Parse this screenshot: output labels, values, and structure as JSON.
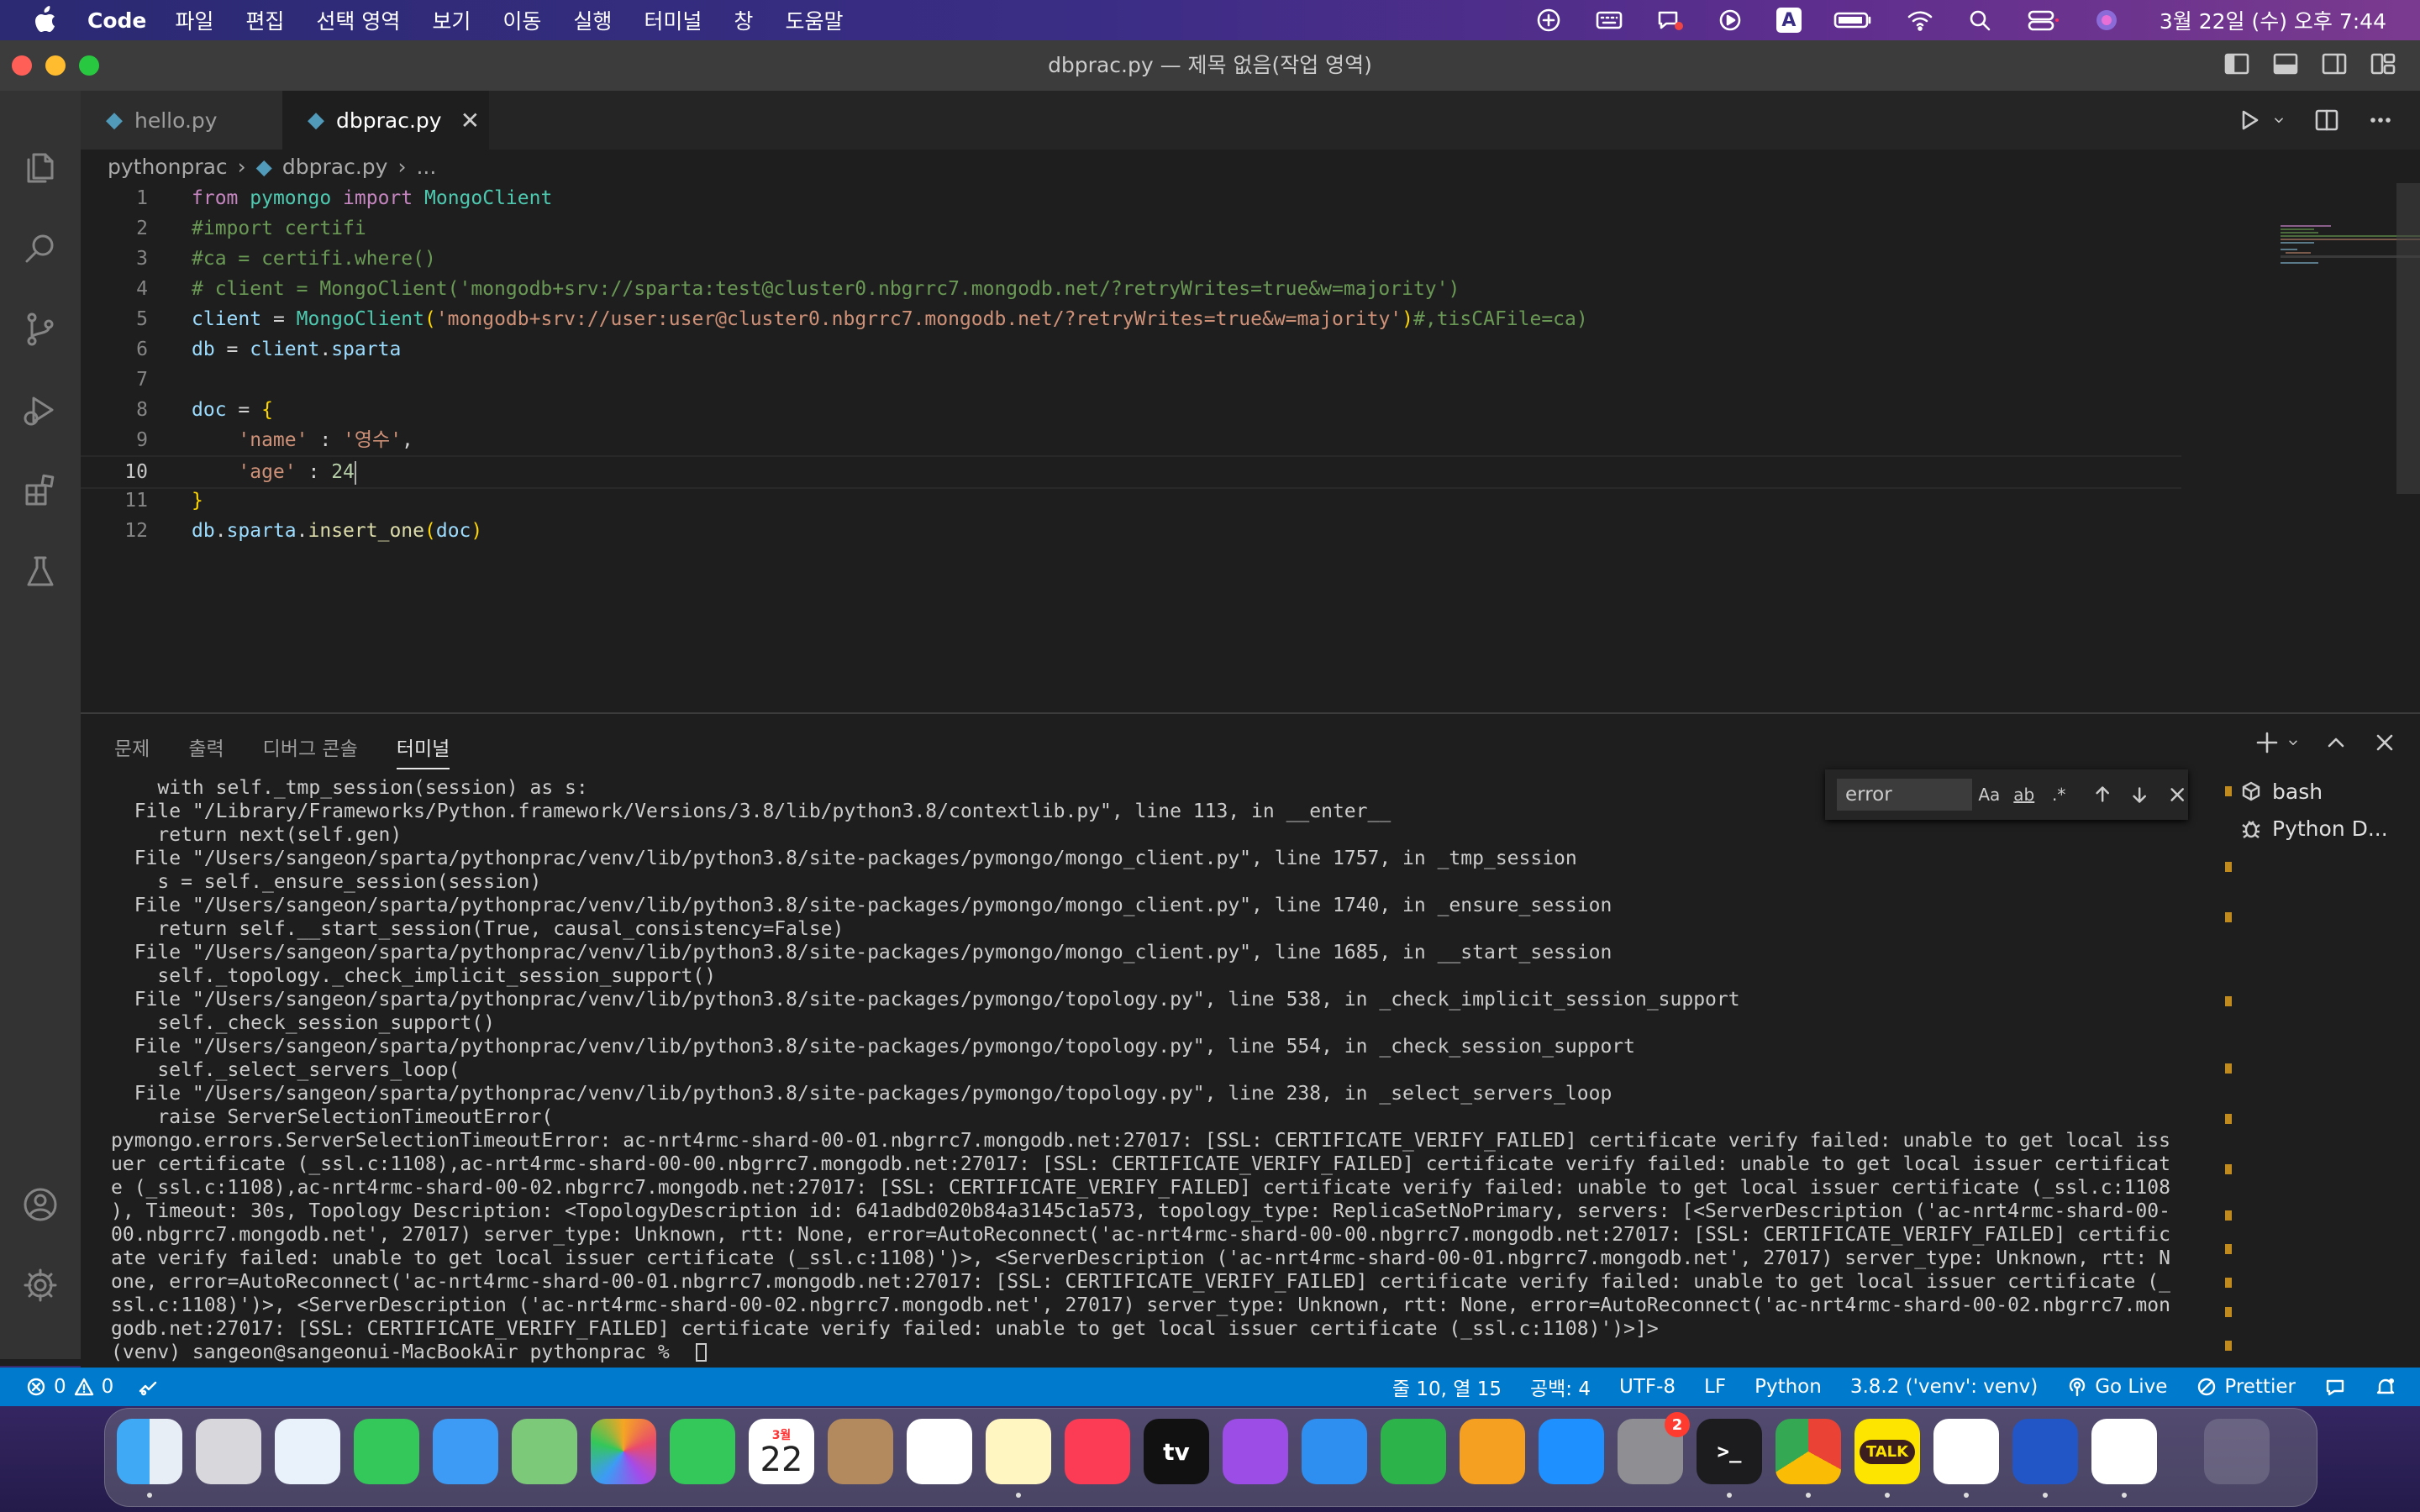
{
  "menubar": {
    "app_name": "Code",
    "menus": [
      "파일",
      "편집",
      "선택 영역",
      "보기",
      "이동",
      "실행",
      "터미널",
      "창",
      "도움말"
    ],
    "clock": "3월 22일 (수) 오후 7:44",
    "status_icons": [
      "apple-icon",
      "puzzle-icon",
      "keyboard-icon",
      "chat-icon",
      "play-circle-icon",
      "input-source-icon",
      "battery-icon",
      "wifi-icon",
      "search-icon",
      "control-center-icon",
      "siri-icon"
    ],
    "input_source": "A"
  },
  "window": {
    "title": "dbprac.py — 제목 없음(작업 영역)"
  },
  "tabs": [
    {
      "label": "hello.py",
      "active": false
    },
    {
      "label": "dbprac.py",
      "active": true
    }
  ],
  "breadcrumb": {
    "folder": "pythonprac",
    "file": "dbprac.py",
    "more": "..."
  },
  "editor": {
    "lines": [
      {
        "n": "1",
        "tokens": [
          [
            "kw",
            "from"
          ],
          [
            "pl",
            " "
          ],
          [
            "mod",
            "pymongo"
          ],
          [
            "pl",
            " "
          ],
          [
            "kw",
            "import"
          ],
          [
            "pl",
            " "
          ],
          [
            "mod",
            "MongoClient"
          ]
        ]
      },
      {
        "n": "2",
        "tokens": [
          [
            "cm",
            "#import certifi"
          ]
        ]
      },
      {
        "n": "3",
        "tokens": [
          [
            "cm",
            "#ca = certifi.where()"
          ]
        ]
      },
      {
        "n": "4",
        "tokens": [
          [
            "cm",
            "# client = MongoClient('mongodb+srv://sparta:test@cluster0.nbgrrc7.mongodb.net/?retryWrites=true&w=majority')"
          ]
        ]
      },
      {
        "n": "5",
        "tokens": [
          [
            "var",
            "client"
          ],
          [
            "pl",
            " = "
          ],
          [
            "mod",
            "MongoClient"
          ],
          [
            "br",
            "("
          ],
          [
            "str",
            "'mongodb+srv://user:user@cluster0.nbgrrc7.mongodb.net/?retryWrites=true&w=majority'"
          ],
          [
            "br",
            ")"
          ],
          [
            "cm",
            "#,tisCAFile=ca)"
          ]
        ]
      },
      {
        "n": "6",
        "tokens": [
          [
            "var",
            "db"
          ],
          [
            "pl",
            " = "
          ],
          [
            "var",
            "client"
          ],
          [
            "pl",
            "."
          ],
          [
            "var",
            "sparta"
          ]
        ]
      },
      {
        "n": "7",
        "tokens": []
      },
      {
        "n": "8",
        "tokens": [
          [
            "var",
            "doc"
          ],
          [
            "pl",
            " = "
          ],
          [
            "br",
            "{"
          ]
        ]
      },
      {
        "n": "9",
        "tokens": [
          [
            "pl",
            "    "
          ],
          [
            "str",
            "'name'"
          ],
          [
            "pl",
            " : "
          ],
          [
            "str",
            "'영수'"
          ],
          [
            "pl",
            ","
          ]
        ]
      },
      {
        "n": "10",
        "tokens": [
          [
            "pl",
            "    "
          ],
          [
            "str",
            "'age'"
          ],
          [
            "pl",
            " : "
          ],
          [
            "num",
            "24"
          ]
        ]
      },
      {
        "n": "11",
        "tokens": [
          [
            "br",
            "}"
          ]
        ]
      },
      {
        "n": "12",
        "tokens": [
          [
            "var",
            "db"
          ],
          [
            "pl",
            "."
          ],
          [
            "var",
            "sparta"
          ],
          [
            "pl",
            "."
          ],
          [
            "fn",
            "insert_one"
          ],
          [
            "br",
            "("
          ],
          [
            "var",
            "doc"
          ],
          [
            "br",
            ")"
          ]
        ]
      }
    ],
    "current_line": "10"
  },
  "panel": {
    "tabs": [
      "문제",
      "출력",
      "디버그 콘솔",
      "터미널"
    ],
    "active_tab": "터미널",
    "find": {
      "value": "error",
      "case_label": "Aa",
      "word_label": "ab",
      "regex_label": ".*"
    },
    "terminals": [
      "bash",
      "Python D..."
    ],
    "output_lines": [
      "    with self._tmp_session(session) as s:",
      "  File \"/Library/Frameworks/Python.framework/Versions/3.8/lib/python3.8/contextlib.py\", line 113, in __enter__",
      "    return next(self.gen)",
      "  File \"/Users/sangeon/sparta/pythonprac/venv/lib/python3.8/site-packages/pymongo/mongo_client.py\", line 1757, in _tmp_session",
      "    s = self._ensure_session(session)",
      "  File \"/Users/sangeon/sparta/pythonprac/venv/lib/python3.8/site-packages/pymongo/mongo_client.py\", line 1740, in _ensure_session",
      "    return self.__start_session(True, causal_consistency=False)",
      "  File \"/Users/sangeon/sparta/pythonprac/venv/lib/python3.8/site-packages/pymongo/mongo_client.py\", line 1685, in __start_session",
      "    self._topology._check_implicit_session_support()",
      "  File \"/Users/sangeon/sparta/pythonprac/venv/lib/python3.8/site-packages/pymongo/topology.py\", line 538, in _check_implicit_session_support",
      "    self._check_session_support()",
      "  File \"/Users/sangeon/sparta/pythonprac/venv/lib/python3.8/site-packages/pymongo/topology.py\", line 554, in _check_session_support",
      "    self._select_servers_loop(",
      "  File \"/Users/sangeon/sparta/pythonprac/venv/lib/python3.8/site-packages/pymongo/topology.py\", line 238, in _select_servers_loop",
      "    raise ServerSelectionTimeoutError(",
      "pymongo.errors.ServerSelectionTimeoutError: ac-nrt4rmc-shard-00-01.nbgrrc7.mongodb.net:27017: [SSL: CERTIFICATE_VERIFY_FAILED] certificate verify failed: unable to get local iss",
      "uer certificate (_ssl.c:1108),ac-nrt4rmc-shard-00-00.nbgrrc7.mongodb.net:27017: [SSL: CERTIFICATE_VERIFY_FAILED] certificate verify failed: unable to get local issuer certificat",
      "e (_ssl.c:1108),ac-nrt4rmc-shard-00-02.nbgrrc7.mongodb.net:27017: [SSL: CERTIFICATE_VERIFY_FAILED] certificate verify failed: unable to get local issuer certificate (_ssl.c:1108",
      "), Timeout: 30s, Topology Description: <TopologyDescription id: 641adbd020b84a3145c1a573, topology_type: ReplicaSetNoPrimary, servers: [<ServerDescription ('ac-nrt4rmc-shard-00-",
      "00.nbgrrc7.mongodb.net', 27017) server_type: Unknown, rtt: None, error=AutoReconnect('ac-nrt4rmc-shard-00-00.nbgrrc7.mongodb.net:27017: [SSL: CERTIFICATE_VERIFY_FAILED] certific",
      "ate verify failed: unable to get local issuer certificate (_ssl.c:1108)')>, <ServerDescription ('ac-nrt4rmc-shard-00-01.nbgrrc7.mongodb.net', 27017) server_type: Unknown, rtt: N",
      "one, error=AutoReconnect('ac-nrt4rmc-shard-00-01.nbgrrc7.mongodb.net:27017: [SSL: CERTIFICATE_VERIFY_FAILED] certificate verify failed: unable to get local issuer certificate (_",
      "ssl.c:1108)')>, <ServerDescription ('ac-nrt4rmc-shard-00-02.nbgrrc7.mongodb.net', 27017) server_type: Unknown, rtt: None, error=AutoReconnect('ac-nrt4rmc-shard-00-02.nbgrrc7.mon",
      "godb.net:27017: [SSL: CERTIFICATE_VERIFY_FAILED] certificate verify failed: unable to get local issuer certificate (_ssl.c:1108)')>]>",
      "(venv) sangeon@sangeonui-MacBookAir pythonprac % "
    ]
  },
  "statusbar": {
    "errors": "0",
    "warnings": "0",
    "position": "줄 10, 열 15",
    "indent": "공백: 4",
    "encoding": "UTF-8",
    "eol": "LF",
    "language": "Python",
    "interpreter": "3.8.2 ('venv': venv)",
    "go_live": "Go Live",
    "prettier": "Prettier"
  },
  "dock": {
    "calendar_month": "3월",
    "calendar_day": "22",
    "settings_badge": "2",
    "tv_label": "tv",
    "talk_label": "TALK",
    "apps": [
      "finder-icon",
      "launchpad-icon",
      "safari-icon",
      "messages-icon",
      "mail-icon",
      "maps-icon",
      "photos-icon",
      "facetime-icon",
      "calendar-icon",
      "contacts-icon",
      "reminders-icon",
      "notes-icon",
      "music-icon",
      "apple-tv-icon",
      "podcasts-icon",
      "keynote-icon",
      "numbers-icon",
      "pages-icon",
      "app-store-icon",
      "system-settings-icon",
      "terminal-icon",
      "chrome-icon",
      "kakaotalk-icon",
      "slack-icon",
      "sourcetree-icon",
      "vscode-icon",
      "trash-icon"
    ]
  },
  "colors": {
    "statusbar": "#007acc",
    "editor_bg": "#1e1e1e",
    "activitybar": "#333333",
    "tabbar": "#252526"
  }
}
